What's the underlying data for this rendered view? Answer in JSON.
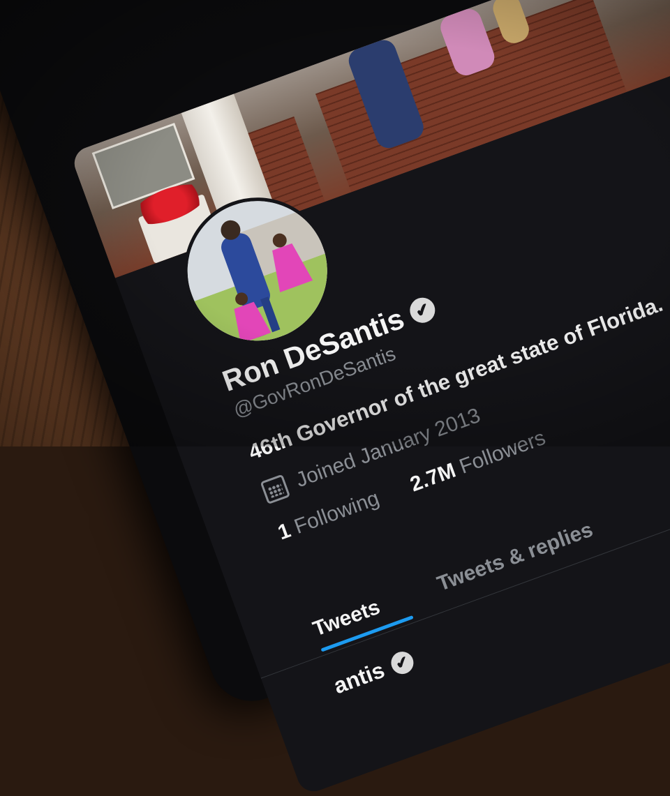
{
  "profile": {
    "display_name": "Ron DeSantis",
    "handle": "@GovRonDeSantis",
    "bio": "46th Governor of the great state of Florida.",
    "joined": "Joined January 2013",
    "following_count": "1",
    "following_label": "Following",
    "followers_count": "2.7M",
    "followers_label": "Followers",
    "verified_glyph": "✔"
  },
  "tabs": {
    "tweets": "Tweets",
    "tweets_replies": "Tweets & replies"
  },
  "tweet_preview": {
    "name_fragment": "antis"
  },
  "colors": {
    "background": "#141418",
    "primary_text": "#f4f4f4",
    "secondary_text": "#8b8f95",
    "accent": "#1d9bf0"
  },
  "icons": {
    "verified": "verified-badge-icon",
    "calendar": "calendar-icon"
  }
}
